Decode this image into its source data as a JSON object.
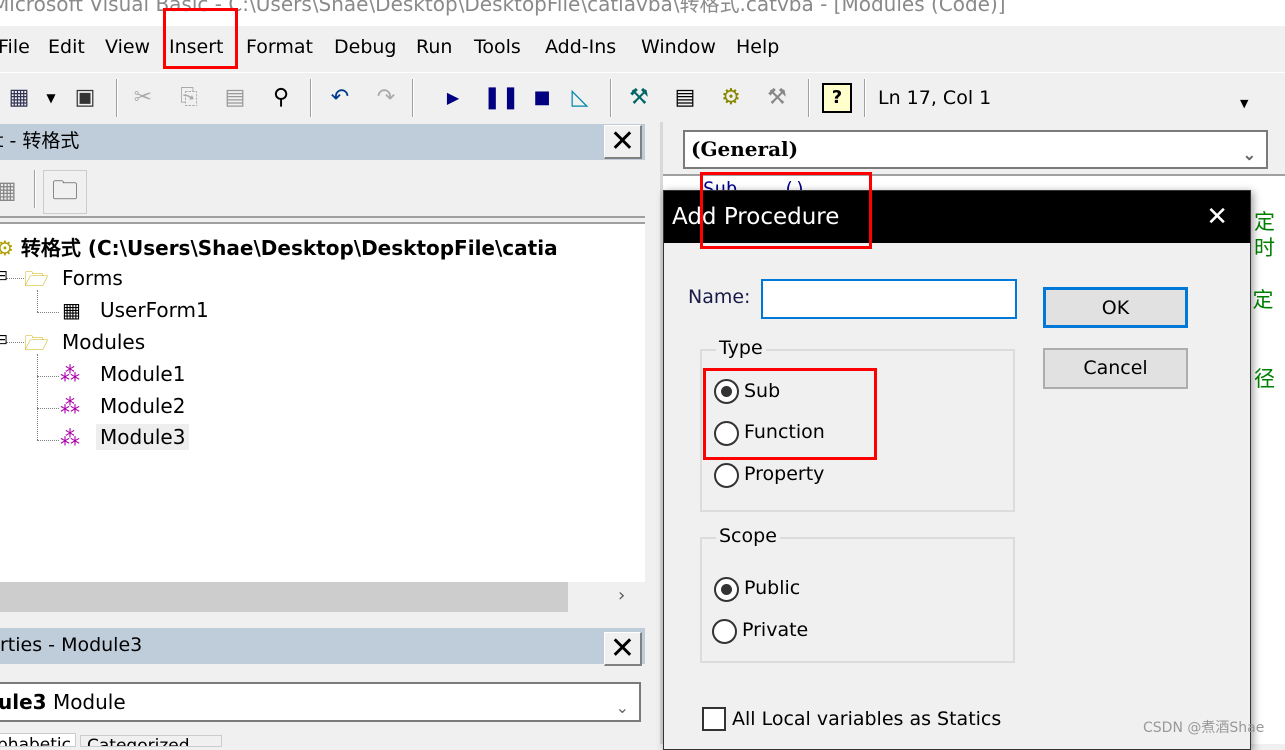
{
  "window": {
    "title": "Microsoft Visual Basic - C:\\Users\\Shae\\Desktop\\DesktopFile\\catiavba\\转格式.catvba - [Modules (Code)]"
  },
  "menu": [
    "File",
    "Edit",
    "View",
    "Insert",
    "Format",
    "Debug",
    "Run",
    "Tools",
    "Add-Ins",
    "Window",
    "Help"
  ],
  "toolbar": {
    "status": "Ln 17, Col 1",
    "icons": [
      "insert-userform-icon",
      "dropdown-arrow-icon",
      "save-icon",
      "cut-icon",
      "copy-icon",
      "paste-icon",
      "find-icon",
      "undo-icon",
      "redo-icon",
      "run-icon",
      "pause-icon",
      "stop-icon",
      "design-mode-icon",
      "project-explorer-icon",
      "properties-icon",
      "object-browser-icon",
      "toolbox-icon",
      "help-icon"
    ]
  },
  "project": {
    "title": "t - 转格式",
    "root": "转格式 (C:\\Users\\Shae\\Desktop\\DesktopFile\\catia",
    "folders": [
      {
        "label": "Forms",
        "items": [
          "UserForm1"
        ]
      },
      {
        "label": "Modules",
        "items": [
          "Module1",
          "Module2",
          "Module3"
        ]
      }
    ],
    "selected": "Module3"
  },
  "properties": {
    "title": "rties - Module3",
    "object_name": "ule3",
    "object_type": "Module",
    "tabs": [
      "phabetic",
      "Categorized"
    ]
  },
  "code": {
    "object_combo": "(General)",
    "partial_line": "Sub ...()",
    "comment_fragments": [
      "定",
      "时",
      "' 定",
      "径"
    ]
  },
  "dialog": {
    "title": "Add Procedure",
    "name_label": "Name:",
    "name_value": "",
    "ok": "OK",
    "cancel": "Cancel",
    "type_label": "Type",
    "types": [
      {
        "label": "Sub",
        "checked": true
      },
      {
        "label": "Function",
        "checked": false
      },
      {
        "label": "Property",
        "checked": false
      }
    ],
    "scope_label": "Scope",
    "scopes": [
      {
        "label": "Public",
        "checked": true
      },
      {
        "label": "Private",
        "checked": false
      }
    ],
    "statics_label": "All Local variables as Statics",
    "statics_checked": false
  },
  "watermark": "CSDN @煮酒Shae",
  "colors": {
    "highlight": "#ff0000",
    "panel_header": "#bfcddb",
    "dialog_title": "#000000",
    "focus": "#0078d7",
    "comment": "#008000"
  }
}
